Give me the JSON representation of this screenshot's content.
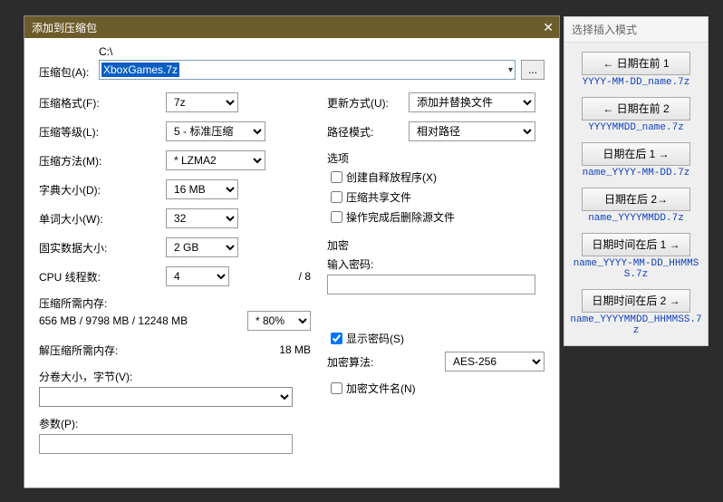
{
  "dialog": {
    "title": "添加到压缩包",
    "close": "✕",
    "archive_label": "压缩包(A):",
    "path_label": "C:\\",
    "path_value": "XboxGames.7z",
    "browse": "...",
    "left": {
      "format_label": "压缩格式(F):",
      "format_value": "7z",
      "level_label": "压缩等级(L):",
      "level_value": "5 - 标准压缩",
      "method_label": "压缩方法(M):",
      "method_value": "* LZMA2",
      "dict_label": "字典大小(D):",
      "dict_value": "16 MB",
      "word_label": "单词大小(W):",
      "word_value": "32",
      "solid_label": "固实数据大小:",
      "solid_value": "2 GB",
      "threads_label": "CPU 线程数:",
      "threads_value": "4",
      "threads_total": "/ 8",
      "mem_comp_label": "压缩所需内存:",
      "mem_comp_value": "656 MB / 9798 MB / 12248 MB",
      "mem_comp_pct": "* 80%",
      "mem_decomp_label": "解压缩所需内存:",
      "mem_decomp_value": "18 MB",
      "split_label": "分卷大小，字节(V):",
      "params_label": "参数(P):"
    },
    "right": {
      "update_label": "更新方式(U):",
      "update_value": "添加并替换文件",
      "pathmode_label": "路径模式:",
      "pathmode_value": "相对路径",
      "options_label": "选项",
      "opt_sfx": "创建自释放程序(X)",
      "opt_shared": "压缩共享文件",
      "opt_delete": "操作完成后删除源文件",
      "enc_label": "加密",
      "pwd_label": "输入密码:",
      "showpwd": "显示密码(S)",
      "algo_label": "加密算法:",
      "algo_value": "AES-256",
      "encnames": "加密文件名(N)"
    }
  },
  "panel": {
    "title": "选择插入模式",
    "buttons": [
      {
        "label": "← 日期在前 1",
        "code": "YYYY-MM-DD_name.7z"
      },
      {
        "label": "← 日期在前 2",
        "code": "YYYYMMDD_name.7z"
      },
      {
        "label": "日期在后 1 →",
        "code": "name_YYYY-MM-DD.7z"
      },
      {
        "label": "日期在后 2→",
        "code": "name_YYYYMMDD.7z"
      },
      {
        "label": "日期时间在后 1 →",
        "code": "name_YYYY-MM-DD_HHMMSS.7z"
      },
      {
        "label": "日期时间在后 2 →",
        "code": "name_YYYYMMDD_HHMMSS.7z"
      }
    ]
  }
}
